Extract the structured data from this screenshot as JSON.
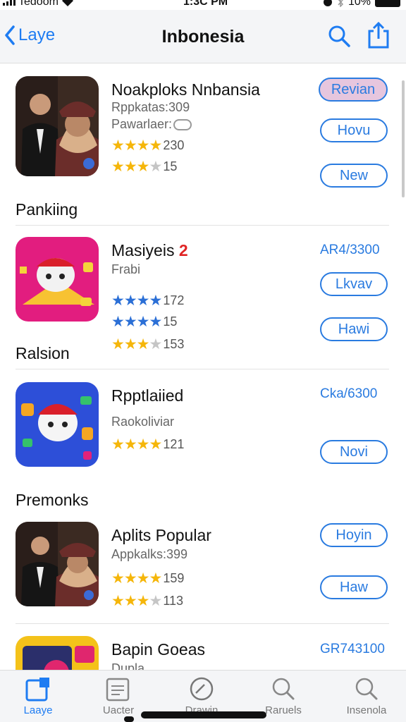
{
  "status": {
    "carrier": "Tedoom",
    "time": "1:3C PM",
    "battery": "10%"
  },
  "nav": {
    "back_label": "Laye",
    "title": "Inbonesia"
  },
  "apps": [
    {
      "name": "Noakploks Nnbansia",
      "line1": "Rppkatas:309",
      "line2": "Pawarlaer:",
      "rating1": 4,
      "count1": "230",
      "rating2": 3,
      "count2": "15",
      "review_label": "Revian",
      "button1": "Hovu",
      "button2": "New"
    },
    {
      "name": "Masiyeis",
      "name_badge": "2",
      "price": "AR4/3300",
      "line1": "Frabi",
      "rating1": 4,
      "count1": "172",
      "rating2": 4,
      "count2": "15",
      "rating3": 3,
      "count3": "153",
      "button1": "Lkvav",
      "button2": "Hawi"
    },
    {
      "name": "Rpptlaiied",
      "price": "Cka/6300",
      "line1": "Raokoliviar",
      "rating1": 4,
      "count1": "121",
      "button1": "Novi"
    },
    {
      "name": "Aplits Popular",
      "line1": "Appkalks:399",
      "rating1": 4,
      "count1": "159",
      "rating2": 3,
      "count2": "113",
      "button1": "Hoyin",
      "button2": "Haw"
    },
    {
      "name": "Bapin Goeas",
      "price": "GR743100",
      "line1": "Dupla"
    }
  ],
  "sections": {
    "ranking": "Pankiing",
    "ralsion": "Ralsion",
    "premonks": "Premonks"
  },
  "tabs": [
    {
      "label": "Laaye",
      "icon": "today-icon"
    },
    {
      "label": "Uacter",
      "icon": "games-icon"
    },
    {
      "label": "Drawin",
      "icon": "apps-icon"
    },
    {
      "label": "Raruels",
      "icon": "search-icon"
    },
    {
      "label": "Insenola",
      "icon": "search-icon"
    }
  ],
  "colors": {
    "accent": "#1e7cf2",
    "star": "#f5b60a",
    "star_blue": "#2b6fd6",
    "review_pill": "#e6c6de"
  }
}
